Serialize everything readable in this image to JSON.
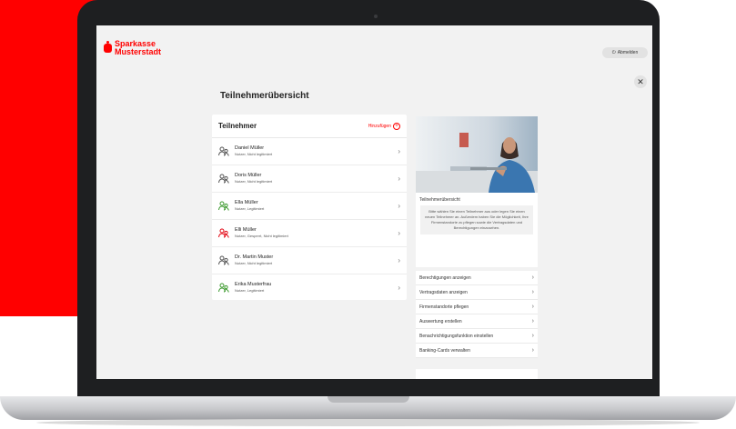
{
  "brand": {
    "line1": "Sparkasse",
    "line2": "Musterstadt",
    "color": "#ff0000"
  },
  "header": {
    "logout_label": "Abmelden",
    "logout_icon": "power-icon",
    "close_icon": "close-icon",
    "close_glyph": "✕"
  },
  "page": {
    "title": "Teilnehmerübersicht"
  },
  "participants": {
    "title": "Teilnehmer",
    "add_label": "Hinzufügen",
    "add_glyph": "+",
    "rows": [
      {
        "name": "Daniel Müller",
        "status": "Nutzer, Nicht legitimiert",
        "icon_color": "#555555"
      },
      {
        "name": "Doris Müller",
        "status": "Nutzer, Nicht legitimiert",
        "icon_color": "#555555"
      },
      {
        "name": "Ella Müller",
        "status": "Nutzer, Legitimiert",
        "icon_color": "#3d9a2f"
      },
      {
        "name": "Elli Müller",
        "status": "Nutzer, Gesperrt, Nicht legitimiert",
        "icon_color": "#e30613"
      },
      {
        "name": "Dr. Martin Muster",
        "status": "Nutzer, Nicht legitimiert",
        "icon_color": "#555555"
      },
      {
        "name": "Erika Musterfrau",
        "status": "Nutzer, Legitimiert",
        "icon_color": "#3d9a2f"
      }
    ],
    "chevron": "›"
  },
  "sidebar": {
    "info_title": "Teilnehmerübersicht",
    "info_text": "Bitte wählen Sie einen Teilnehmer aus oder legen Sie einen neuen Teilnehmer an. Außerdem haben Sie die Möglichkeit, Ihre Firmenstandorte zu pflegen sowie die Vertragsdaten und Berechtigungen einzusehen.",
    "links": [
      "Berechtigungen anzeigen",
      "Vertragsdaten anzeigen",
      "Firmenstandorte pflegen",
      "Auswertung erstellen",
      "Benachrichtigungsfunktion einstellen",
      "Banking-Cards verwalten"
    ],
    "chevron": "›"
  }
}
